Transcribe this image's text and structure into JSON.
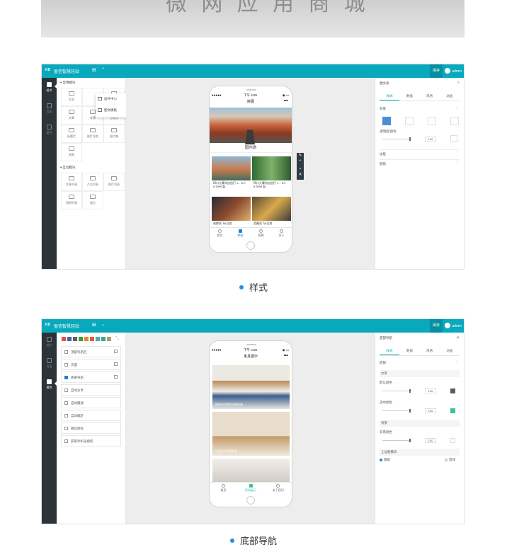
{
  "banner": {
    "text": "微 网 应 用 商 城"
  },
  "shot1": {
    "topbar": {
      "logo": "KD",
      "site": "盈信智慧轻站",
      "save": "保存",
      "user": "admin"
    },
    "rail": [
      "组件",
      "页面",
      "属性"
    ],
    "sections": {
      "common": "常用模块",
      "interact": "互动模块"
    },
    "widgets": [
      "文本",
      "",
      "",
      "文章",
      "轮播",
      "分割线",
      "标题栏",
      "图片导航",
      "图片集",
      "视频"
    ],
    "interact_widgets": [
      "文章列表",
      "产品列表",
      "照片列表",
      "相册列表",
      "留言"
    ],
    "flyout": [
      "站外中心",
      "图文模板"
    ],
    "phone": {
      "status_dots": "●●●●●",
      "time": "下午 4:55",
      "battery": "◉ ▭",
      "title": "拼图",
      "more": "•••",
      "category": "国内游",
      "cards": [
        {
          "title": "四川九寨沟自由行 1... 5人",
          "price": "¥ 3999 起"
        },
        {
          "title": "四川九寨沟自由行 1... 5人",
          "price": "¥ 5999 起"
        },
        {
          "title": "成都双飞6日游",
          "price": ""
        },
        {
          "title": "西藏双飞6日游",
          "price": ""
        }
      ],
      "tabs": [
        "首页",
        "拼图",
        "招聘",
        "关于"
      ]
    },
    "tools": [
      "✎",
      "⌃",
      "⌄",
      "✕"
    ],
    "right": {
      "header": "图文表",
      "tabs": [
        "样式",
        "数据",
        "风格",
        "动画"
      ],
      "bg_label": "背景",
      "opacity_label": "透明度/颜色",
      "opacity_value": "100",
      "rows": [
        "边框",
        "圆角"
      ]
    }
  },
  "caption1": "样式",
  "shot2": {
    "topbar": {
      "logo": "KD",
      "site": "盈信智慧轻站",
      "save": "保存",
      "user": "admin"
    },
    "rail": [
      "组件",
      "页面",
      "属性"
    ],
    "palette": [
      "#e34d4d",
      "#4d5ea6",
      "#5a5f74",
      "#3f9a3f",
      "#e6862d",
      "#e25b3b",
      "#50a8b9",
      "#3aa68d",
      "#b09a76"
    ],
    "pages": [
      {
        "label": "顶部导航栏",
        "checked": false
      },
      {
        "label": "页面",
        "checked": false
      },
      {
        "label": "底部导航",
        "checked": true
      },
      {
        "label": "自动分享",
        "checked": false
      },
      {
        "label": "自动播放",
        "checked": false
      },
      {
        "label": "自动确定",
        "checked": false
      },
      {
        "label": "微信授权",
        "checked": false
      },
      {
        "label": "获取手机号授权",
        "checked": false
      }
    ],
    "phone": {
      "status_dots": "●●●●●",
      "time": "下午 4:55",
      "battery": "◉ ▭",
      "title": "家具展示",
      "more": "•••",
      "cards": [
        "北欧现代简约风格家具",
        "日式原木风格家具",
        ""
      ],
      "tabs": [
        "首页",
        "家具展示",
        "关于我们"
      ]
    },
    "right": {
      "header": "底部导航",
      "tabs": [
        "样式",
        "数据",
        "风格",
        "动画"
      ],
      "group": "底部",
      "text_label": "文字",
      "default_color": "默认颜色",
      "default_value": "100",
      "selected_color": "选中颜色",
      "selected_value": "100",
      "bg_section": "背景",
      "bg_color": "背景颜色",
      "bg_value": "100",
      "border_label": "上边框模块",
      "radio_a": "圆角",
      "radio_b": "直线",
      "swatch_default": "#5b5b5b",
      "swatch_selected": "#3bbf9e"
    }
  },
  "caption2": "底部导航"
}
